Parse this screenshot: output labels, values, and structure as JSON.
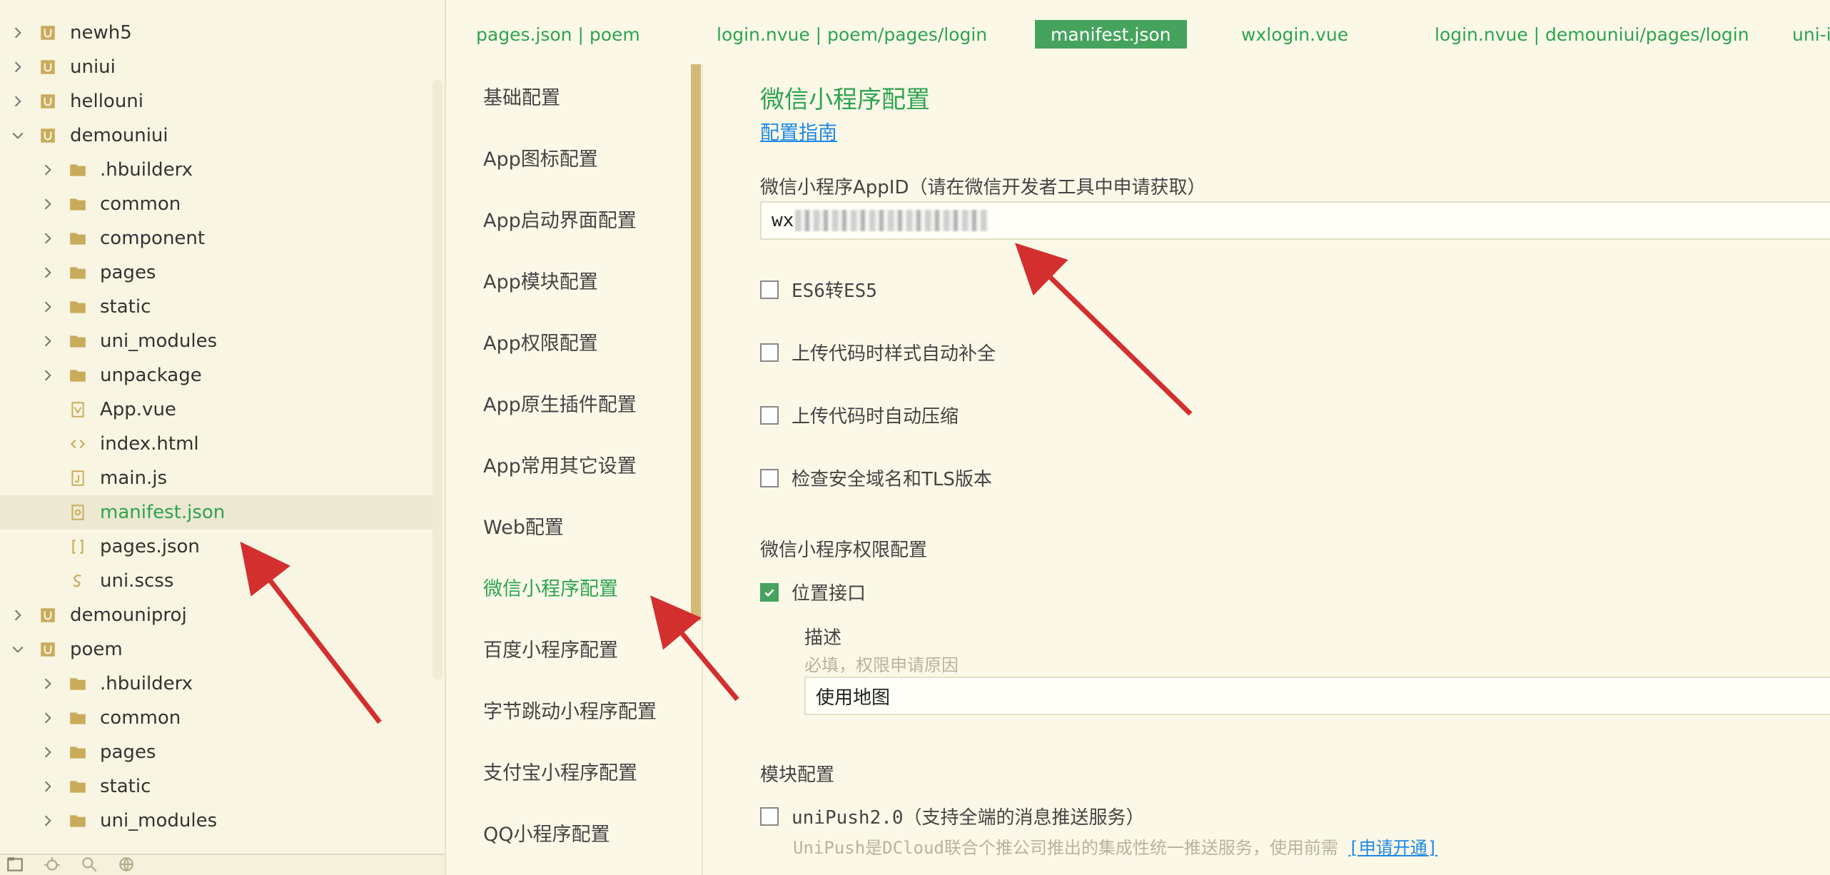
{
  "tree": {
    "items": [
      {
        "label": "newh5",
        "type": "project",
        "expanded": false,
        "depth": 0
      },
      {
        "label": "uniui",
        "type": "project",
        "expanded": false,
        "depth": 0
      },
      {
        "label": "hellouni",
        "type": "project",
        "expanded": false,
        "depth": 0
      },
      {
        "label": "demouniui",
        "type": "project",
        "expanded": true,
        "depth": 0
      },
      {
        "label": ".hbuilderx",
        "type": "folder",
        "expanded": false,
        "depth": 1
      },
      {
        "label": "common",
        "type": "folder",
        "expanded": false,
        "depth": 1
      },
      {
        "label": "component",
        "type": "folder",
        "expanded": false,
        "depth": 1
      },
      {
        "label": "pages",
        "type": "folder",
        "expanded": false,
        "depth": 1
      },
      {
        "label": "static",
        "type": "folder",
        "expanded": false,
        "depth": 1
      },
      {
        "label": "uni_modules",
        "type": "folder",
        "expanded": false,
        "depth": 1
      },
      {
        "label": "unpackage",
        "type": "folder",
        "expanded": false,
        "depth": 1
      },
      {
        "label": "App.vue",
        "type": "vue",
        "depth": 1
      },
      {
        "label": "index.html",
        "type": "html",
        "depth": 1
      },
      {
        "label": "main.js",
        "type": "js",
        "depth": 1
      },
      {
        "label": "manifest.json",
        "type": "manifest",
        "depth": 1,
        "selected": true
      },
      {
        "label": "pages.json",
        "type": "json",
        "depth": 1
      },
      {
        "label": "uni.scss",
        "type": "scss",
        "depth": 1
      },
      {
        "label": "demouniproj",
        "type": "project",
        "expanded": false,
        "depth": 0
      },
      {
        "label": "poem",
        "type": "project",
        "expanded": true,
        "depth": 0
      },
      {
        "label": ".hbuilderx",
        "type": "folder",
        "expanded": false,
        "depth": 1
      },
      {
        "label": "common",
        "type": "folder",
        "expanded": false,
        "depth": 1
      },
      {
        "label": "pages",
        "type": "folder",
        "expanded": false,
        "depth": 1
      },
      {
        "label": "static",
        "type": "folder",
        "expanded": false,
        "depth": 1
      },
      {
        "label": "uni_modules",
        "type": "folder",
        "expanded": false,
        "depth": 1
      }
    ]
  },
  "tabs": [
    {
      "label": "pages.json | poem",
      "active": false
    },
    {
      "label": "login.nvue | poem/pages/login",
      "active": false
    },
    {
      "label": "manifest.json",
      "active": true
    },
    {
      "label": "wxlogin.vue",
      "active": false
    },
    {
      "label": "login.nvue | demouniui/pages/login",
      "active": false
    },
    {
      "label": "uni-i",
      "active": false
    }
  ],
  "nav": {
    "items": [
      {
        "label": "基础配置",
        "active": false
      },
      {
        "label": "App图标配置",
        "active": false
      },
      {
        "label": "App启动界面配置",
        "active": false
      },
      {
        "label": "App模块配置",
        "active": false
      },
      {
        "label": "App权限配置",
        "active": false
      },
      {
        "label": "App原生插件配置",
        "active": false
      },
      {
        "label": "App常用其它设置",
        "active": false
      },
      {
        "label": "Web配置",
        "active": false
      },
      {
        "label": "微信小程序配置",
        "active": true
      },
      {
        "label": "百度小程序配置",
        "active": false
      },
      {
        "label": "字节跳动小程序配置",
        "active": false
      },
      {
        "label": "支付宝小程序配置",
        "active": false
      },
      {
        "label": "QQ小程序配置",
        "active": false
      }
    ]
  },
  "content": {
    "title": "微信小程序配置",
    "guide_link": "配置指南",
    "appid_label": "微信小程序AppID（请在微信开发者工具中申请获取）",
    "appid_value_prefix": "wx",
    "checkboxes": [
      {
        "label": "ES6转ES5",
        "checked": false
      },
      {
        "label": "上传代码时样式自动补全",
        "checked": false
      },
      {
        "label": "上传代码时自动压缩",
        "checked": false
      },
      {
        "label": "检查安全域名和TLS版本",
        "checked": false
      }
    ],
    "permission_title": "微信小程序权限配置",
    "location": {
      "label": "位置接口",
      "checked": true
    },
    "desc_label": "描述",
    "desc_hint": "必填，权限申请原因",
    "desc_value": "使用地图",
    "module_title": "模块配置",
    "unipush": {
      "label": "uniPush2.0（支持全端的消息推送服务）",
      "checked": false,
      "hint": "UniPush是DCloud联合个推公司推出的集成性统一推送服务，使用前需",
      "apply": "[申请开通]"
    }
  },
  "colors": {
    "accent": "#2ea44f",
    "active_tab": "#46a35e",
    "link": "#1e88e5",
    "arrow": "#d32f2f",
    "folder": "#c9ab5b"
  }
}
